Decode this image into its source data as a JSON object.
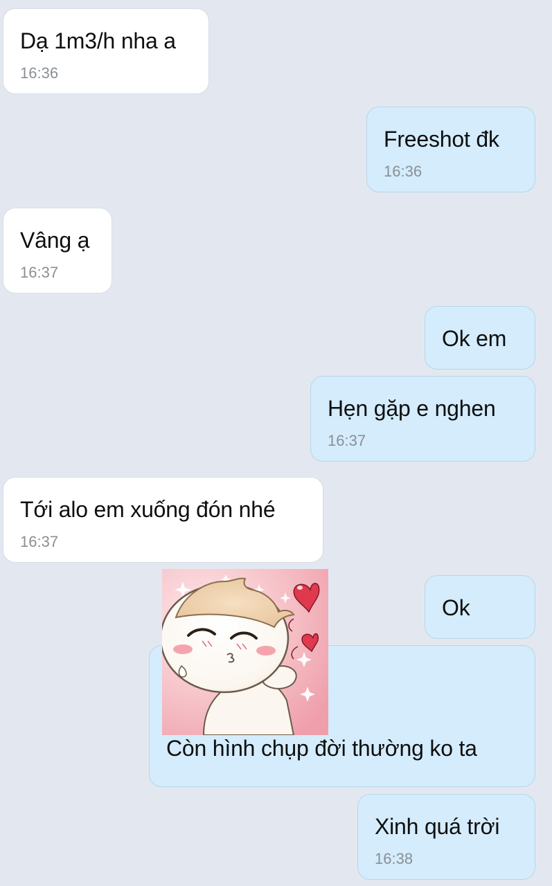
{
  "messages": [
    {
      "text": "Dạ 1m3/h nha a",
      "time": "16:36"
    },
    {
      "text": "Freeshot đk",
      "time": "16:36"
    },
    {
      "text": "Vâng ạ",
      "time": "16:37"
    },
    {
      "text": "Ok em",
      "time": ""
    },
    {
      "text": "Hẹn gặp e nghen",
      "time": "16:37"
    },
    {
      "text": "Tới alo em xuống đón nhé",
      "time": "16:37"
    },
    {
      "text": "Ok",
      "time": ""
    },
    {
      "text": "Còn hình chụp đời thường ko ta",
      "time": ""
    },
    {
      "text": "Xinh quá trời",
      "time": "16:38"
    }
  ],
  "sticker": {
    "icon": "blowing-kiss-sticker-icon"
  },
  "colors": {
    "background": "#e3e8f0",
    "incoming_bubble": "#ffffff",
    "outgoing_bubble": "#d4ecfb",
    "time_text": "#8a8f96"
  }
}
